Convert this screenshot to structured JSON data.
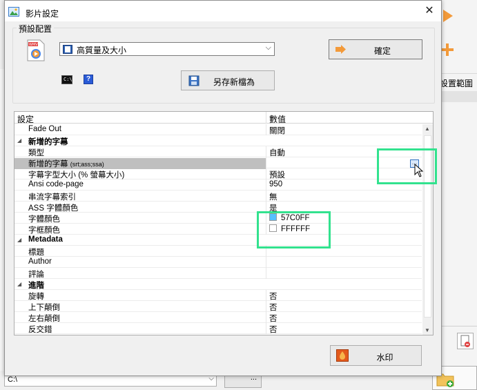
{
  "dialog": {
    "title": "影片設定",
    "close_glyph": "✕"
  },
  "preset": {
    "group_label": "預設配置",
    "selected": "高質量及大小",
    "ok_label": "確定",
    "save_as_label": "另存新檔為"
  },
  "grid": {
    "col_setting": "設定",
    "col_value": "數值",
    "rows": [
      {
        "name": "Fade Out",
        "value": ""
      },
      {
        "name": "新增的字幕",
        "value": ""
      },
      {
        "name": "類型",
        "value": "自動"
      },
      {
        "name": "新增的字幕",
        "hint": "(srt;ass;ssa)",
        "value": ""
      },
      {
        "name": "字幕字型大小 (% 螢幕大小)",
        "value": "預設"
      },
      {
        "name": "Ansi code-page",
        "value": "950"
      },
      {
        "name": "串流字幕索引",
        "value": "無"
      },
      {
        "name": "ASS 字體顏色",
        "value": "是"
      },
      {
        "name": "字體顏色",
        "value": "57C0FF",
        "swatch": "#57C0FF"
      },
      {
        "name": "字框顏色",
        "value": "FFFFFF",
        "swatch": "#FFFFFF"
      },
      {
        "name": "Metadata",
        "value": ""
      },
      {
        "name": "標題",
        "value": ""
      },
      {
        "name": "Author",
        "value": ""
      },
      {
        "name": "評論",
        "value": ""
      },
      {
        "name": "進階",
        "value": ""
      },
      {
        "name": "旋轉",
        "value": "否"
      },
      {
        "name": "上下顛倒",
        "value": "否"
      },
      {
        "name": "左右顛倒",
        "value": "否"
      },
      {
        "name": "反交錯",
        "value": "否"
      }
    ],
    "fade_out_value": "關閉"
  },
  "watermark": {
    "label": "水印"
  },
  "background": {
    "range_label": "設置範圍",
    "path": "C:\\",
    "dots": "..."
  },
  "colors": {
    "highlight": "#32E28E",
    "font_color": "#57C0FF",
    "border_color": "#FFFFFF"
  }
}
